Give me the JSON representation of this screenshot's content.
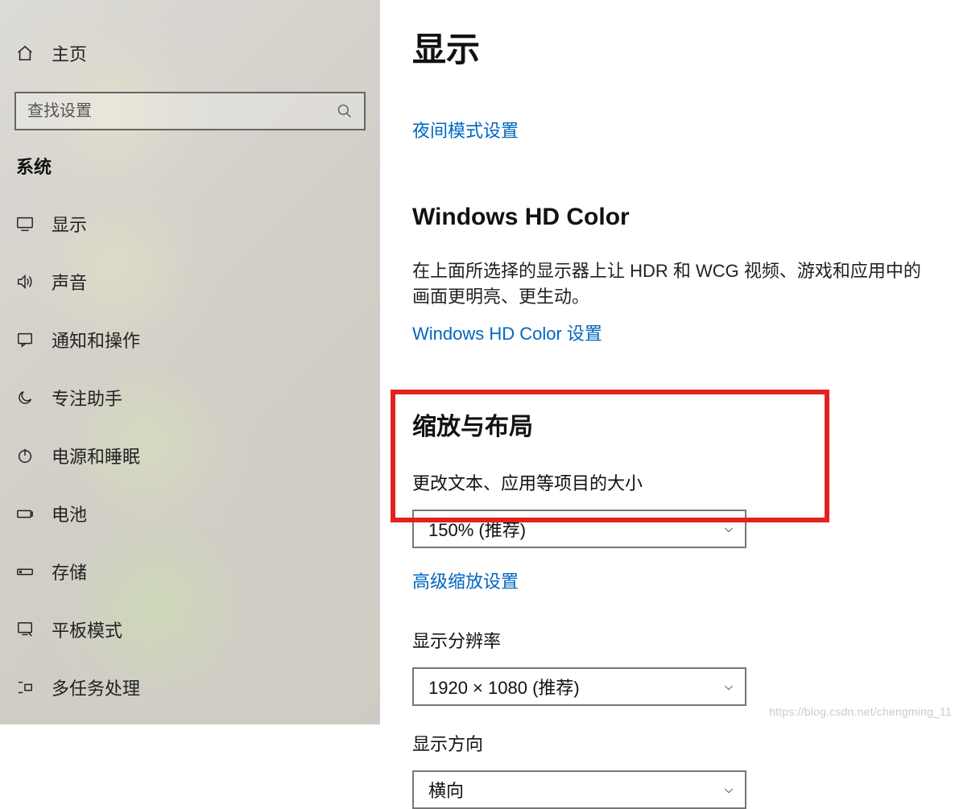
{
  "sidebar": {
    "home_label": "主页",
    "search_placeholder": "查找设置",
    "section_title": "系统",
    "items": [
      {
        "label": "显示"
      },
      {
        "label": "声音"
      },
      {
        "label": "通知和操作"
      },
      {
        "label": "专注助手"
      },
      {
        "label": "电源和睡眠"
      },
      {
        "label": "电池"
      },
      {
        "label": "存储"
      },
      {
        "label": "平板模式"
      },
      {
        "label": "多任务处理"
      }
    ]
  },
  "main": {
    "title": "显示",
    "night_mode_link": "夜间模式设置",
    "hd_color": {
      "heading": "Windows HD Color",
      "body": "在上面所选择的显示器上让 HDR 和 WCG 视频、游戏和应用中的画面更明亮、更生动。",
      "link": "Windows HD Color 设置"
    },
    "scale": {
      "heading": "缩放与布局",
      "text_size_label": "更改文本、应用等项目的大小",
      "text_size_value": "150% (推荐)",
      "advanced_link": "高级缩放设置",
      "resolution_label": "显示分辨率",
      "resolution_value": "1920 × 1080 (推荐)",
      "orientation_label": "显示方向",
      "orientation_value": "横向"
    }
  },
  "watermark": "https://blog.csdn.net/chengming_11"
}
